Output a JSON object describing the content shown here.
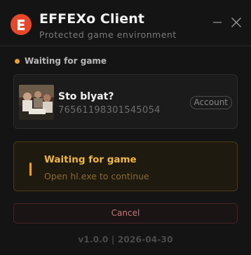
{
  "app": {
    "title": "EFFEXo Client",
    "subtitle": "Protected game environment",
    "logo_letter": "E",
    "accent": "#e8482a"
  },
  "window_controls": {
    "minimize_icon": "minimize-icon",
    "close_icon": "close-icon"
  },
  "status": {
    "text": "Waiting for game",
    "dot_color": "#e6a22c"
  },
  "account": {
    "name": "Sto blyat?",
    "steam_id": "76561198301545054",
    "badge": "Account"
  },
  "waiting": {
    "title": "Waiting for game",
    "message": "Open hl.exe to continue",
    "color": "#f0b740"
  },
  "cancel": {
    "label": "Cancel"
  },
  "footer": {
    "text": "v1.0.0 | 2026-04-30"
  }
}
